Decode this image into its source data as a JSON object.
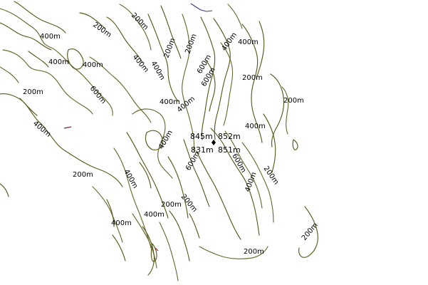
{
  "map": {
    "colors": {
      "background": "#ffffff",
      "contour": "#5a5a1e",
      "contour_dark": "#6b6b33",
      "water": "#3a3a7a",
      "marsh": "#7a2a2a",
      "text": "#000000"
    },
    "contour_labels": [
      "200m",
      "400m",
      "600m"
    ],
    "peak": {
      "icon": "summit-marker-icon",
      "labels": [
        "845m",
        "852m",
        "831m",
        "851m"
      ]
    }
  }
}
